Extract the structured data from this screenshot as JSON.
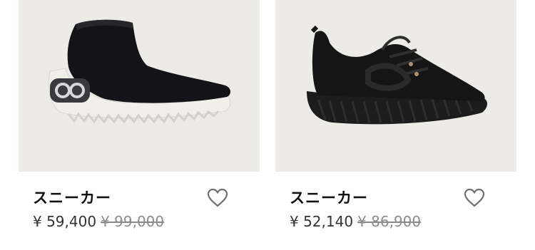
{
  "products": [
    {
      "name": "スニーカー",
      "price": "¥ 59,400",
      "original_price": "¥ 99,000",
      "image_icon": "sock-sneaker-image",
      "colors": {
        "upper": "#141418",
        "sole": "#f1efe9",
        "logo": "#3a3a3e"
      }
    },
    {
      "name": "スニーカー",
      "price": "¥ 52,140",
      "original_price": "¥ 86,900",
      "image_icon": "black-sneaker-image",
      "colors": {
        "upper": "#151515",
        "sole": "#1c1c1c"
      }
    }
  ],
  "wishlist_icon": "heart-outline-icon",
  "image_background": "#ecebe7"
}
